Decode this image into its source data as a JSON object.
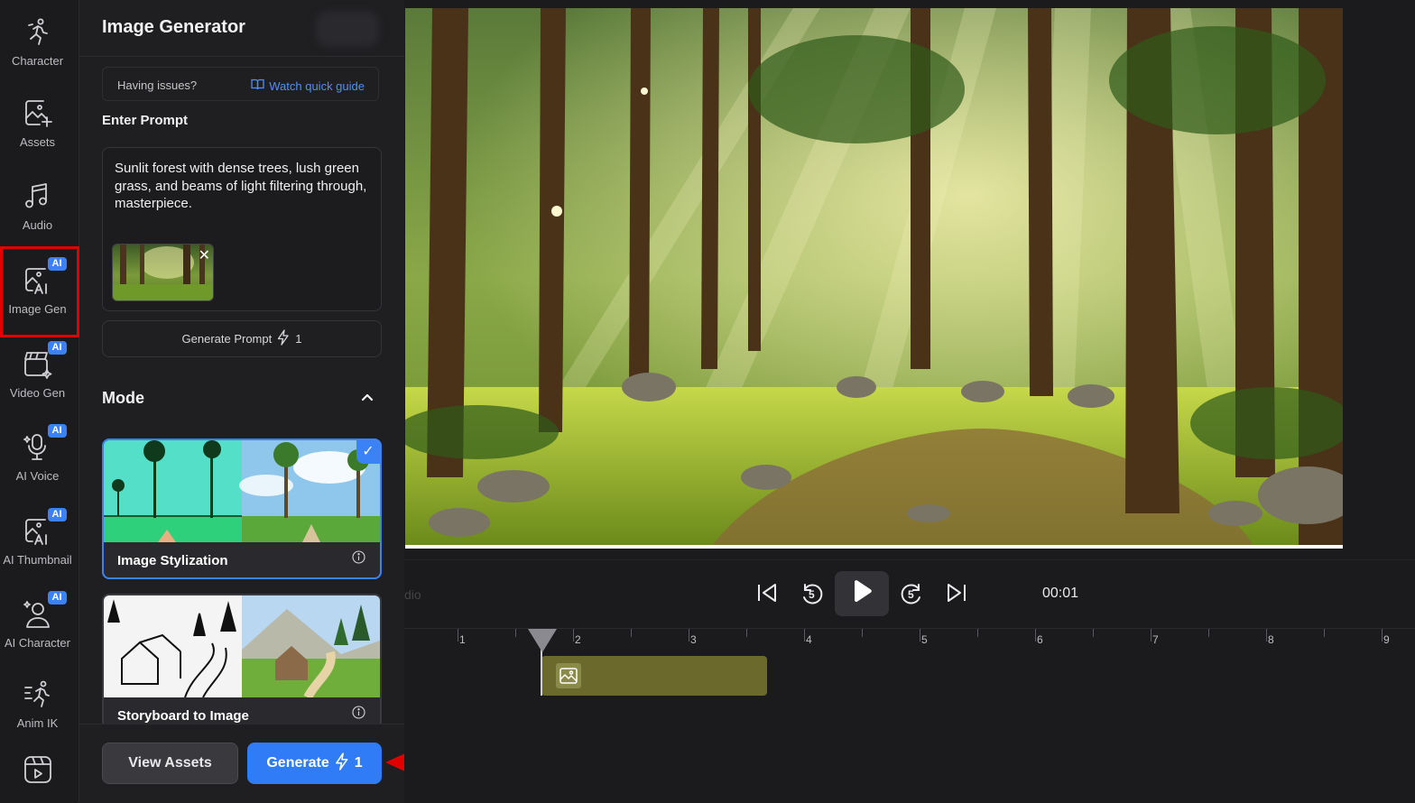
{
  "rail": {
    "items": [
      {
        "label": "Character",
        "icon": "character-run-icon",
        "ai": false
      },
      {
        "label": "Assets",
        "icon": "image-add-icon",
        "ai": false
      },
      {
        "label": "Audio",
        "icon": "music-note-icon",
        "ai": false
      },
      {
        "label": "Image Gen",
        "icon": "ai-image-icon",
        "ai": true
      },
      {
        "label": "Video Gen",
        "icon": "clapperboard-sparkle-icon",
        "ai": true
      },
      {
        "label": "AI Voice",
        "icon": "microphone-sparkle-icon",
        "ai": true
      },
      {
        "label": "AI Thumbnail",
        "icon": "ai-image-icon",
        "ai": true
      },
      {
        "label": "AI Character",
        "icon": "person-sparkle-icon",
        "ai": true
      },
      {
        "label": "Anim IK",
        "icon": "running-figure-icon",
        "ai": false
      },
      {
        "label": "",
        "icon": "video-reel-icon",
        "ai": false
      }
    ],
    "ai_badge": "AI",
    "active": "Image Gen"
  },
  "panel": {
    "title": "Image Generator",
    "help_text": "Having issues?",
    "help_link": "Watch quick guide",
    "prompt_heading": "Enter Prompt",
    "prompt_text": "Sunlit forest with dense trees, lush green grass, and beams of light filtering through, masterpiece.",
    "thumb_close": "✕",
    "generate_prompt_label": "Generate Prompt",
    "generate_prompt_cost": "1",
    "mode_heading": "Mode",
    "modes": [
      {
        "name": "Image Stylization",
        "selected": true
      },
      {
        "name": "Storyboard to Image",
        "selected": false
      }
    ],
    "view_assets_label": "View Assets",
    "generate_label": "Generate",
    "generate_cost": "1"
  },
  "player": {
    "audio_label": "dio",
    "time": "00:01",
    "skip_seconds": "5"
  },
  "timeline": {
    "ticks": [
      "1",
      "2",
      "3",
      "4",
      "5",
      "6",
      "7",
      "8",
      "9"
    ]
  },
  "colors": {
    "accent": "#3b82f6",
    "highlight": "#e00000",
    "clip": "#6b6a2c"
  }
}
